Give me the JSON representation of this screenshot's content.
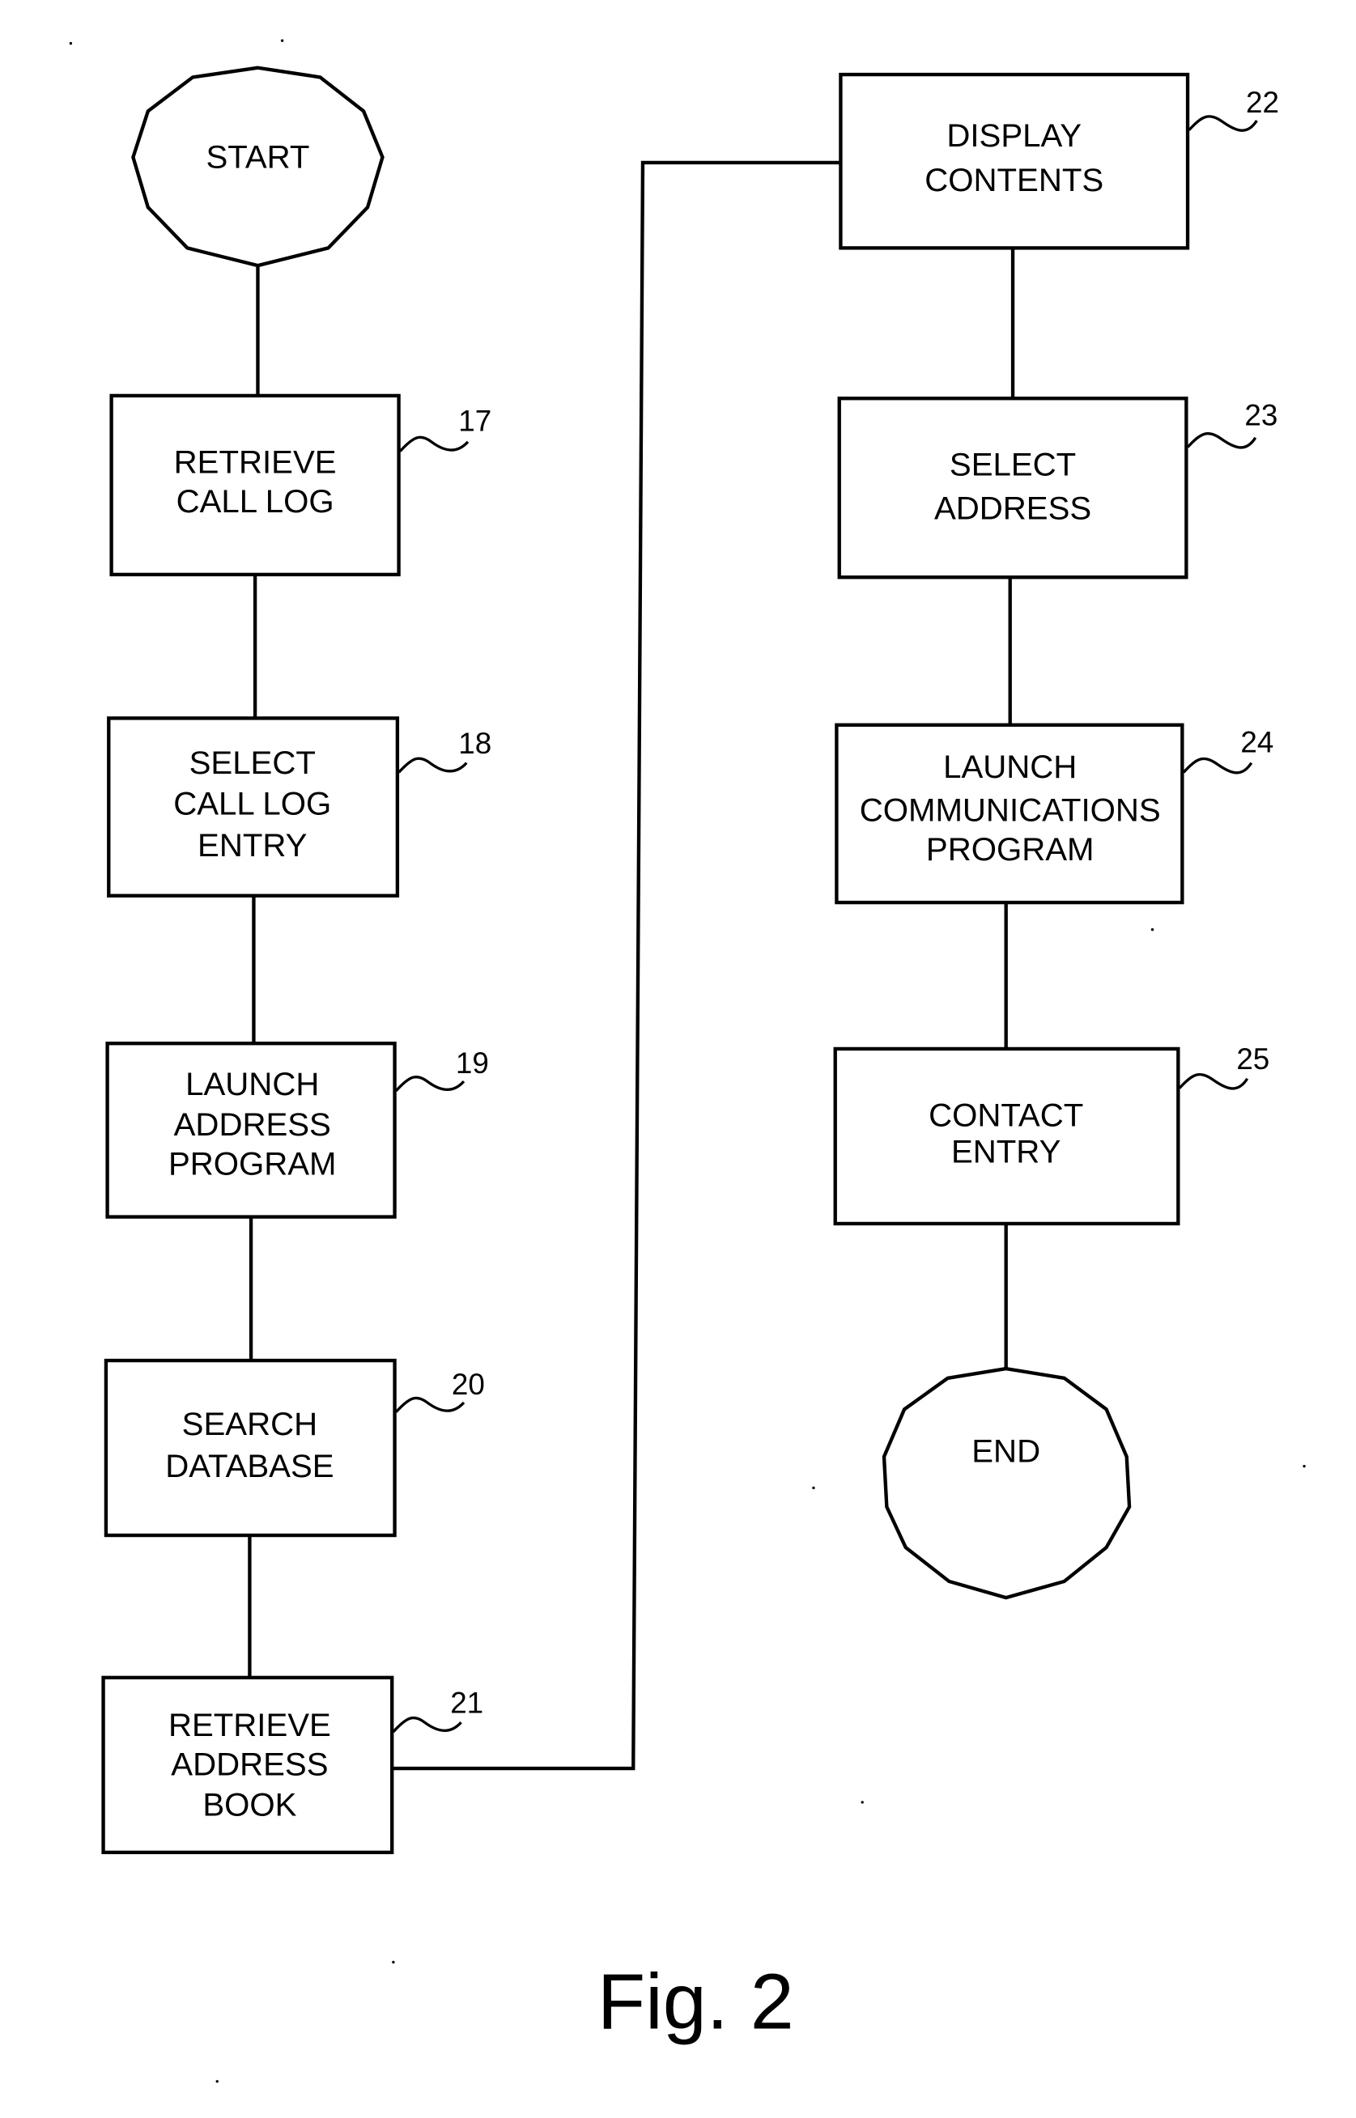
{
  "figure": {
    "caption": "Fig. 2",
    "terminals": {
      "start": "START",
      "end": "END"
    },
    "steps": [
      {
        "ref": "17",
        "lines": [
          "RETRIEVE",
          "CALL LOG"
        ]
      },
      {
        "ref": "18",
        "lines": [
          "SELECT",
          "CALL LOG",
          "ENTRY"
        ]
      },
      {
        "ref": "19",
        "lines": [
          "LAUNCH",
          "ADDRESS",
          "PROGRAM"
        ]
      },
      {
        "ref": "20",
        "lines": [
          "SEARCH",
          "DATABASE"
        ]
      },
      {
        "ref": "21",
        "lines": [
          "RETRIEVE",
          "ADDRESS",
          "BOOK"
        ]
      },
      {
        "ref": "22",
        "lines": [
          "DISPLAY",
          "CONTENTS"
        ]
      },
      {
        "ref": "23",
        "lines": [
          "SELECT",
          "ADDRESS"
        ]
      },
      {
        "ref": "24",
        "lines": [
          "LAUNCH",
          "COMMUNICATIONS",
          "PROGRAM"
        ]
      },
      {
        "ref": "25",
        "lines": [
          "CONTACT",
          "ENTRY"
        ]
      }
    ]
  }
}
